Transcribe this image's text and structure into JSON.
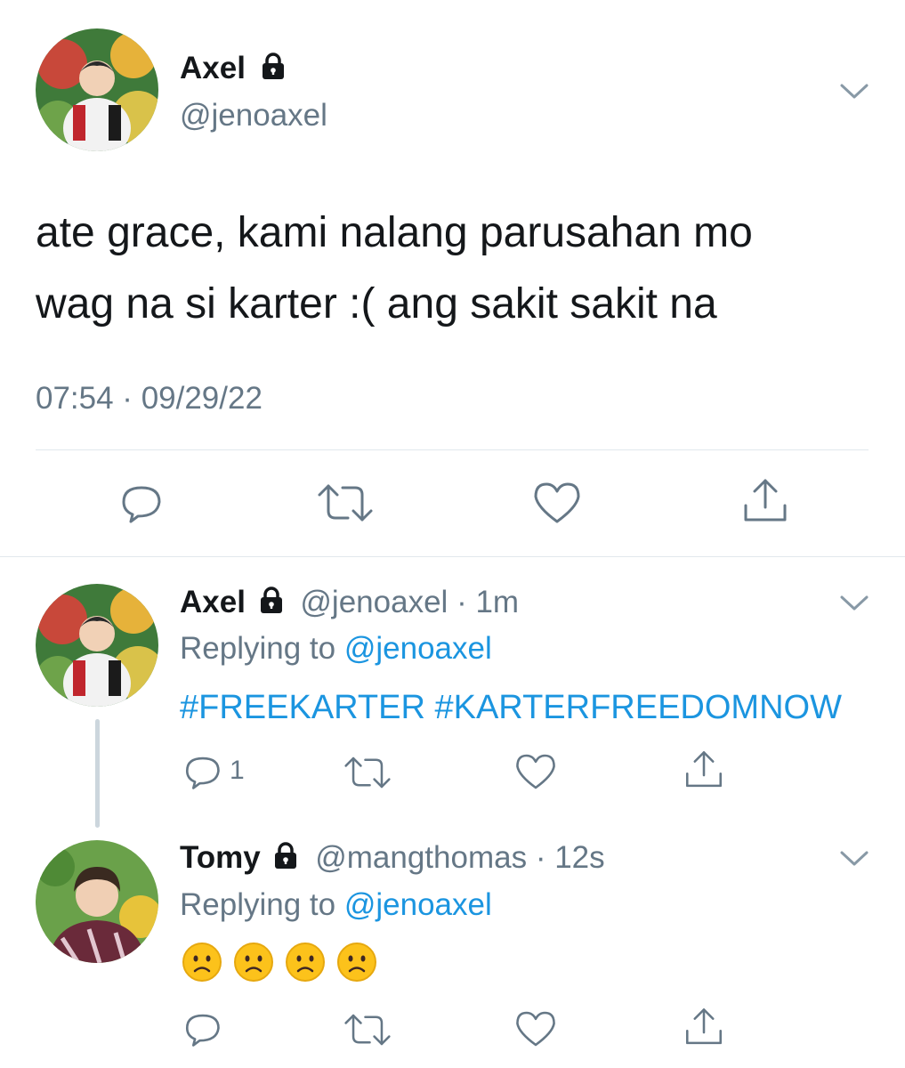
{
  "main_tweet": {
    "display_name": "Axel",
    "handle": "@jenoaxel",
    "text_line1": "ate grace, kami nalang parusahan mo",
    "text_line2": "wag na si karter :( ang sakit sakit na",
    "timestamp": "07:54 · 09/29/22",
    "avatar_icon": "profile-photo-axel",
    "actions": [
      "reply-icon",
      "retweet-icon",
      "like-icon",
      "share-icon"
    ]
  },
  "replies": [
    {
      "display_name": "Axel",
      "handle": "@jenoaxel",
      "time": "· 1m",
      "replying_prefix": "Replying to",
      "replying_to": "@jenoaxel",
      "text": "#FREEKARTER #KARTERFREEDOMNOW",
      "reply_count": "1"
    },
    {
      "display_name": "Tomy",
      "handle": "@mangthomas",
      "time": "· 12s",
      "replying_prefix": "Replying to",
      "replying_to": "@jenoaxel",
      "emojis": [
        "frowning-face",
        "frowning-face",
        "frowning-face",
        "frowning-face"
      ]
    }
  ],
  "colors": {
    "text": "#14171a",
    "muted": "#657786",
    "link": "#1b95e0",
    "divider": "#e1e8ed"
  }
}
